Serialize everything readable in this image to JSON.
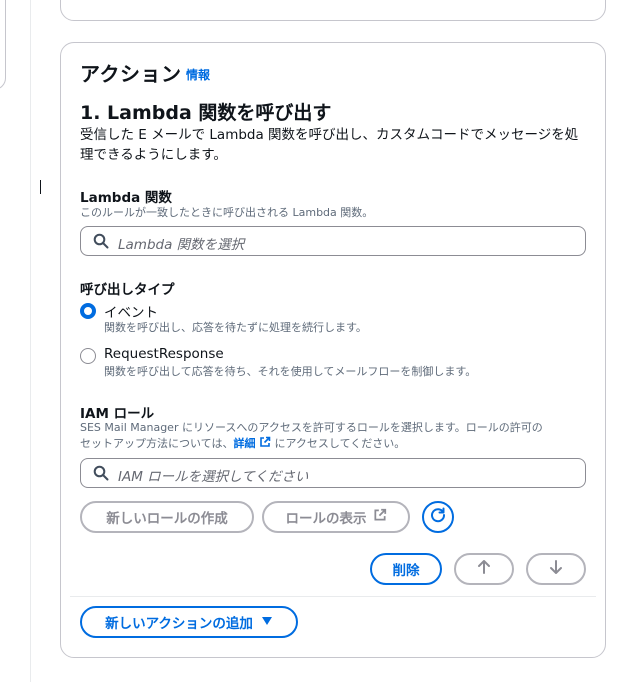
{
  "section": {
    "heading": "アクション",
    "info_link": "情報"
  },
  "action": {
    "title": "1. Lambda 関数を呼び出す",
    "description": "受信した E メールで Lambda 関数を呼び出し、カスタムコードでメッセージを処理できるようにします。"
  },
  "lambda_field": {
    "label": "Lambda 関数",
    "hint": "このルールが一致したときに呼び出される Lambda 関数。",
    "placeholder": "Lambda 関数を選択"
  },
  "invocation": {
    "label": "呼び出しタイプ",
    "options": [
      {
        "label": "イベント",
        "desc": "関数を呼び出し、応答を待たずに処理を続行します。",
        "selected": true
      },
      {
        "label": "RequestResponse",
        "desc": "関数を呼び出して応答を待ち、それを使用してメールフローを制御します。",
        "selected": false
      }
    ]
  },
  "iam_role": {
    "label": "IAM ロール",
    "hint_line1": "SES Mail Manager にリソースへのアクセスを許可するロールを選択します。ロールの許可の",
    "hint_line2_prefix": "セットアップ方法については、",
    "hint_link": "詳細",
    "hint_line2_suffix": "にアクセスしてください。",
    "placeholder": "IAM ロールを選択してください",
    "create_button": "新しいロールの作成",
    "view_button": "ロールの表示"
  },
  "footer_buttons": {
    "delete": "削除",
    "add_action": "新しいアクションの追加"
  },
  "colors": {
    "accent": "#006ce0",
    "border": "#c6c6cd",
    "disabled": "#b4b4bb",
    "text": "#0f141a",
    "muted": "#5f6b7a"
  }
}
